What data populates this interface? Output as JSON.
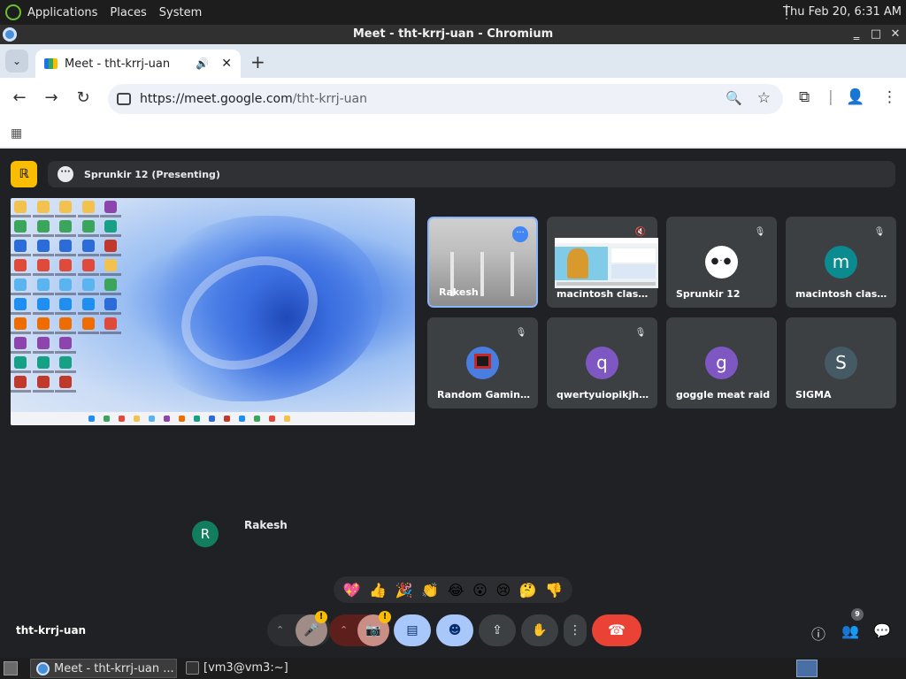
{
  "os_panel": {
    "menus": [
      "Applications",
      "Places",
      "System"
    ],
    "clock": "Thu Feb 20, 6:31 AM"
  },
  "window": {
    "title": "Meet - tht-krrj-uan - Chromium"
  },
  "browser": {
    "tab_title": "Meet - tht-krrj-uan",
    "url_host": "https://meet.google.com",
    "url_path": "/tht-krrj-uan"
  },
  "meet": {
    "presenter_badge": "Sprunkir 12 (Presenting)",
    "presenter_icon_text": "ℝ",
    "participants": [
      {
        "name": "Rakesh",
        "avatar": "",
        "color": "",
        "muted": false
      },
      {
        "name": "macintosh classic ...",
        "avatar": "",
        "color": "",
        "muted": true
      },
      {
        "name": "Sprunkir 12",
        "avatar": "",
        "color": "#ffffff",
        "muted": true
      },
      {
        "name": "macintosh classic 1",
        "avatar": "m",
        "color": "#0b8a8f",
        "muted": true
      },
      {
        "name": "Random Gamingin...",
        "avatar": "",
        "color": "#4a7de0",
        "muted": true
      },
      {
        "name": "qwertyuiopikjhgfd...",
        "avatar": "q",
        "color": "#7e57c2",
        "muted": true
      },
      {
        "name": "goggle meat raid",
        "avatar": "g",
        "color": "#7e57c2",
        "muted": false
      },
      {
        "name": "SIGMA",
        "avatar": "S",
        "color": "#455a64",
        "muted": false
      }
    ],
    "floating_participant": {
      "initial": "R",
      "name": "Rakesh"
    },
    "reactions": [
      "💖",
      "👍",
      "🎉",
      "👏",
      "😂",
      "😮",
      "😢",
      "🤔",
      "👎"
    ],
    "meeting_code": "tht-krrj-uan",
    "people_count": "9"
  },
  "os_taskbar": {
    "tasks": [
      "Meet - tht-krrj-uan ...",
      "[vm3@vm3:~]"
    ]
  },
  "colors": {
    "meet_bg": "#202124",
    "tile_bg": "#3c4043",
    "end_call": "#ea4335",
    "active_blue": "#8ab4f8"
  }
}
